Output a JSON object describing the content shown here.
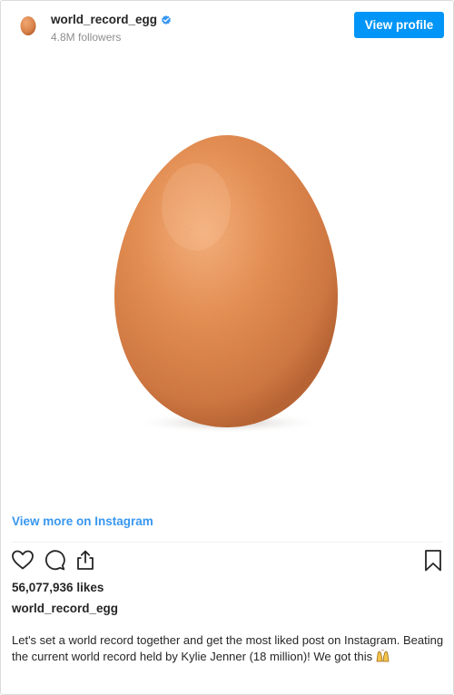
{
  "header": {
    "username": "world_record_egg",
    "followers": "4.8M followers",
    "view_profile_label": "View profile"
  },
  "post": {
    "image_subject": "brown egg",
    "view_more_label": "View more on Instagram",
    "likes": "56,077,936 likes",
    "caption_username": "world_record_egg",
    "caption_text": "Let's set a world record together and get the most liked post on Instagram. Beating the current world record held by Kylie Jenner (18 million)! We got this "
  },
  "icons": {
    "like": "heart-icon",
    "comment": "comment-icon",
    "share": "share-icon",
    "save": "bookmark-icon",
    "verified": "verified-badge-icon",
    "emoji": "raising-hands-emoji-icon"
  },
  "colors": {
    "accent": "#0095f6",
    "link": "#3897f0",
    "text": "#262626",
    "muted": "#8e8e8e",
    "egg": "#e0894e"
  }
}
